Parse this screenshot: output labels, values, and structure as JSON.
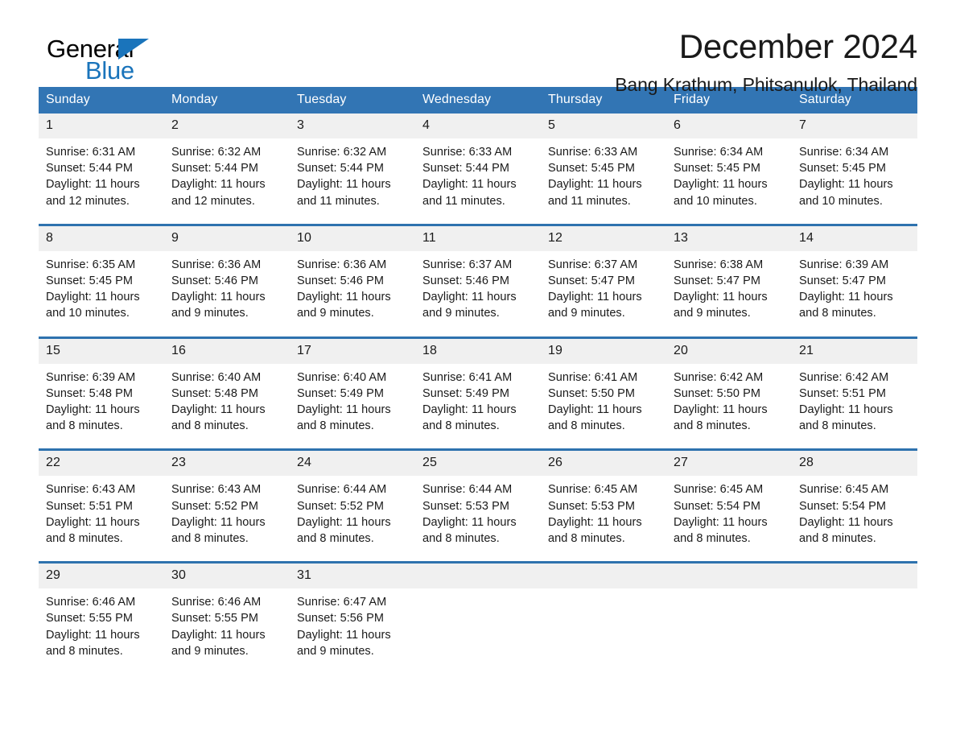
{
  "brand": {
    "name_top": "General",
    "name_bottom": "Blue",
    "triangle_color": "#1a74bb"
  },
  "header": {
    "month_title": "December 2024",
    "location": "Bang Krathum, Phitsanulok, Thailand",
    "header_bg_color": "#3275b4",
    "separator_color": "#2e72ae",
    "daynum_bg_color": "#f0f0f0"
  },
  "calendar": {
    "weekday_headers": [
      "Sunday",
      "Monday",
      "Tuesday",
      "Wednesday",
      "Thursday",
      "Friday",
      "Saturday"
    ],
    "weeks": [
      {
        "days": [
          {
            "num": "1",
            "sunrise": "Sunrise: 6:31 AM",
            "sunset": "Sunset: 5:44 PM",
            "daylight_1": "Daylight: 11 hours",
            "daylight_2": "and 12 minutes."
          },
          {
            "num": "2",
            "sunrise": "Sunrise: 6:32 AM",
            "sunset": "Sunset: 5:44 PM",
            "daylight_1": "Daylight: 11 hours",
            "daylight_2": "and 12 minutes."
          },
          {
            "num": "3",
            "sunrise": "Sunrise: 6:32 AM",
            "sunset": "Sunset: 5:44 PM",
            "daylight_1": "Daylight: 11 hours",
            "daylight_2": "and 11 minutes."
          },
          {
            "num": "4",
            "sunrise": "Sunrise: 6:33 AM",
            "sunset": "Sunset: 5:44 PM",
            "daylight_1": "Daylight: 11 hours",
            "daylight_2": "and 11 minutes."
          },
          {
            "num": "5",
            "sunrise": "Sunrise: 6:33 AM",
            "sunset": "Sunset: 5:45 PM",
            "daylight_1": "Daylight: 11 hours",
            "daylight_2": "and 11 minutes."
          },
          {
            "num": "6",
            "sunrise": "Sunrise: 6:34 AM",
            "sunset": "Sunset: 5:45 PM",
            "daylight_1": "Daylight: 11 hours",
            "daylight_2": "and 10 minutes."
          },
          {
            "num": "7",
            "sunrise": "Sunrise: 6:34 AM",
            "sunset": "Sunset: 5:45 PM",
            "daylight_1": "Daylight: 11 hours",
            "daylight_2": "and 10 minutes."
          }
        ]
      },
      {
        "days": [
          {
            "num": "8",
            "sunrise": "Sunrise: 6:35 AM",
            "sunset": "Sunset: 5:45 PM",
            "daylight_1": "Daylight: 11 hours",
            "daylight_2": "and 10 minutes."
          },
          {
            "num": "9",
            "sunrise": "Sunrise: 6:36 AM",
            "sunset": "Sunset: 5:46 PM",
            "daylight_1": "Daylight: 11 hours",
            "daylight_2": "and 9 minutes."
          },
          {
            "num": "10",
            "sunrise": "Sunrise: 6:36 AM",
            "sunset": "Sunset: 5:46 PM",
            "daylight_1": "Daylight: 11 hours",
            "daylight_2": "and 9 minutes."
          },
          {
            "num": "11",
            "sunrise": "Sunrise: 6:37 AM",
            "sunset": "Sunset: 5:46 PM",
            "daylight_1": "Daylight: 11 hours",
            "daylight_2": "and 9 minutes."
          },
          {
            "num": "12",
            "sunrise": "Sunrise: 6:37 AM",
            "sunset": "Sunset: 5:47 PM",
            "daylight_1": "Daylight: 11 hours",
            "daylight_2": "and 9 minutes."
          },
          {
            "num": "13",
            "sunrise": "Sunrise: 6:38 AM",
            "sunset": "Sunset: 5:47 PM",
            "daylight_1": "Daylight: 11 hours",
            "daylight_2": "and 9 minutes."
          },
          {
            "num": "14",
            "sunrise": "Sunrise: 6:39 AM",
            "sunset": "Sunset: 5:47 PM",
            "daylight_1": "Daylight: 11 hours",
            "daylight_2": "and 8 minutes."
          }
        ]
      },
      {
        "days": [
          {
            "num": "15",
            "sunrise": "Sunrise: 6:39 AM",
            "sunset": "Sunset: 5:48 PM",
            "daylight_1": "Daylight: 11 hours",
            "daylight_2": "and 8 minutes."
          },
          {
            "num": "16",
            "sunrise": "Sunrise: 6:40 AM",
            "sunset": "Sunset: 5:48 PM",
            "daylight_1": "Daylight: 11 hours",
            "daylight_2": "and 8 minutes."
          },
          {
            "num": "17",
            "sunrise": "Sunrise: 6:40 AM",
            "sunset": "Sunset: 5:49 PM",
            "daylight_1": "Daylight: 11 hours",
            "daylight_2": "and 8 minutes."
          },
          {
            "num": "18",
            "sunrise": "Sunrise: 6:41 AM",
            "sunset": "Sunset: 5:49 PM",
            "daylight_1": "Daylight: 11 hours",
            "daylight_2": "and 8 minutes."
          },
          {
            "num": "19",
            "sunrise": "Sunrise: 6:41 AM",
            "sunset": "Sunset: 5:50 PM",
            "daylight_1": "Daylight: 11 hours",
            "daylight_2": "and 8 minutes."
          },
          {
            "num": "20",
            "sunrise": "Sunrise: 6:42 AM",
            "sunset": "Sunset: 5:50 PM",
            "daylight_1": "Daylight: 11 hours",
            "daylight_2": "and 8 minutes."
          },
          {
            "num": "21",
            "sunrise": "Sunrise: 6:42 AM",
            "sunset": "Sunset: 5:51 PM",
            "daylight_1": "Daylight: 11 hours",
            "daylight_2": "and 8 minutes."
          }
        ]
      },
      {
        "days": [
          {
            "num": "22",
            "sunrise": "Sunrise: 6:43 AM",
            "sunset": "Sunset: 5:51 PM",
            "daylight_1": "Daylight: 11 hours",
            "daylight_2": "and 8 minutes."
          },
          {
            "num": "23",
            "sunrise": "Sunrise: 6:43 AM",
            "sunset": "Sunset: 5:52 PM",
            "daylight_1": "Daylight: 11 hours",
            "daylight_2": "and 8 minutes."
          },
          {
            "num": "24",
            "sunrise": "Sunrise: 6:44 AM",
            "sunset": "Sunset: 5:52 PM",
            "daylight_1": "Daylight: 11 hours",
            "daylight_2": "and 8 minutes."
          },
          {
            "num": "25",
            "sunrise": "Sunrise: 6:44 AM",
            "sunset": "Sunset: 5:53 PM",
            "daylight_1": "Daylight: 11 hours",
            "daylight_2": "and 8 minutes."
          },
          {
            "num": "26",
            "sunrise": "Sunrise: 6:45 AM",
            "sunset": "Sunset: 5:53 PM",
            "daylight_1": "Daylight: 11 hours",
            "daylight_2": "and 8 minutes."
          },
          {
            "num": "27",
            "sunrise": "Sunrise: 6:45 AM",
            "sunset": "Sunset: 5:54 PM",
            "daylight_1": "Daylight: 11 hours",
            "daylight_2": "and 8 minutes."
          },
          {
            "num": "28",
            "sunrise": "Sunrise: 6:45 AM",
            "sunset": "Sunset: 5:54 PM",
            "daylight_1": "Daylight: 11 hours",
            "daylight_2": "and 8 minutes."
          }
        ]
      },
      {
        "days": [
          {
            "num": "29",
            "sunrise": "Sunrise: 6:46 AM",
            "sunset": "Sunset: 5:55 PM",
            "daylight_1": "Daylight: 11 hours",
            "daylight_2": "and 8 minutes."
          },
          {
            "num": "30",
            "sunrise": "Sunrise: 6:46 AM",
            "sunset": "Sunset: 5:55 PM",
            "daylight_1": "Daylight: 11 hours",
            "daylight_2": "and 9 minutes."
          },
          {
            "num": "31",
            "sunrise": "Sunrise: 6:47 AM",
            "sunset": "Sunset: 5:56 PM",
            "daylight_1": "Daylight: 11 hours",
            "daylight_2": "and 9 minutes."
          },
          {
            "num": "",
            "sunrise": "",
            "sunset": "",
            "daylight_1": "",
            "daylight_2": ""
          },
          {
            "num": "",
            "sunrise": "",
            "sunset": "",
            "daylight_1": "",
            "daylight_2": ""
          },
          {
            "num": "",
            "sunrise": "",
            "sunset": "",
            "daylight_1": "",
            "daylight_2": ""
          },
          {
            "num": "",
            "sunrise": "",
            "sunset": "",
            "daylight_1": "",
            "daylight_2": ""
          }
        ]
      }
    ]
  }
}
